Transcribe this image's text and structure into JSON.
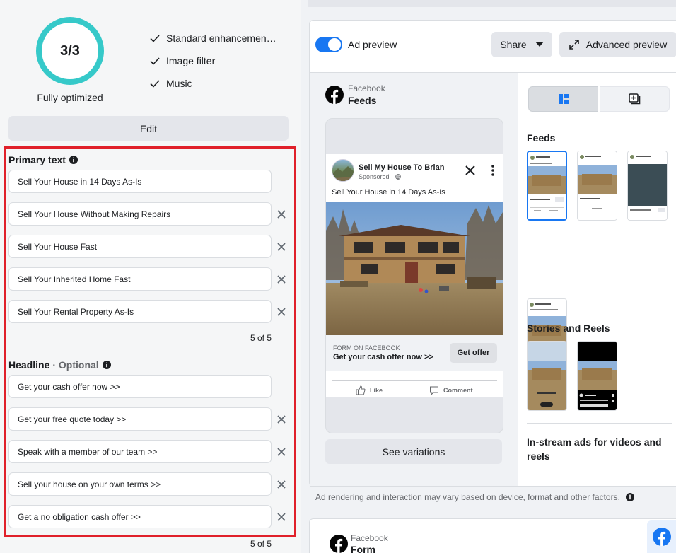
{
  "optimization": {
    "score": "3/3",
    "status": "Fully optimized",
    "enhancements": [
      "Standard enhancemen…",
      "Image filter",
      "Music"
    ],
    "edit_label": "Edit",
    "ring_color": "#36c9c9"
  },
  "primary_text": {
    "label": "Primary text",
    "items": [
      "Sell Your House in 14 Days As-Is",
      "Sell Your House Without Making Repairs",
      "Sell Your House Fast",
      "Sell Your Inherited Home Fast",
      "Sell Your Rental Property As-Is"
    ],
    "count": "5 of 5"
  },
  "headline": {
    "label": "Headline",
    "optional_label": "· Optional",
    "items": [
      "Get your cash offer now >>",
      "Get your free quote today >>",
      "Speak with a member of our team >>",
      "Sell your house on your own terms >>",
      "Get a no obligation cash offer >>"
    ],
    "count": "5 of 5"
  },
  "preview": {
    "toggle_label": "Ad preview",
    "share_label": "Share",
    "advanced_label": "Advanced preview",
    "platform": "Facebook",
    "placement": "Feeds",
    "post": {
      "page_name": "Sell My House To Brian",
      "sponsored": "Sponsored · ",
      "text": "Sell Your House in 14 Days As-Is",
      "cta_small": "FORM ON FACEBOOK",
      "cta_headline": "Get your cash offer now >>",
      "cta_button": "Get offer",
      "like": "Like",
      "comment": "Comment"
    },
    "see_variations": "See variations",
    "side": {
      "feeds_heading": "Feeds",
      "stories_heading": "Stories and Reels",
      "instream_heading": "In-stream ads for videos and reels"
    },
    "disclaimer": "Ad rendering and interaction may vary based on device, format and other factors.",
    "second_card": {
      "platform": "Facebook",
      "placement": "Form"
    }
  },
  "colors": {
    "accent": "#1877f2",
    "highlight": "#e0202a"
  }
}
